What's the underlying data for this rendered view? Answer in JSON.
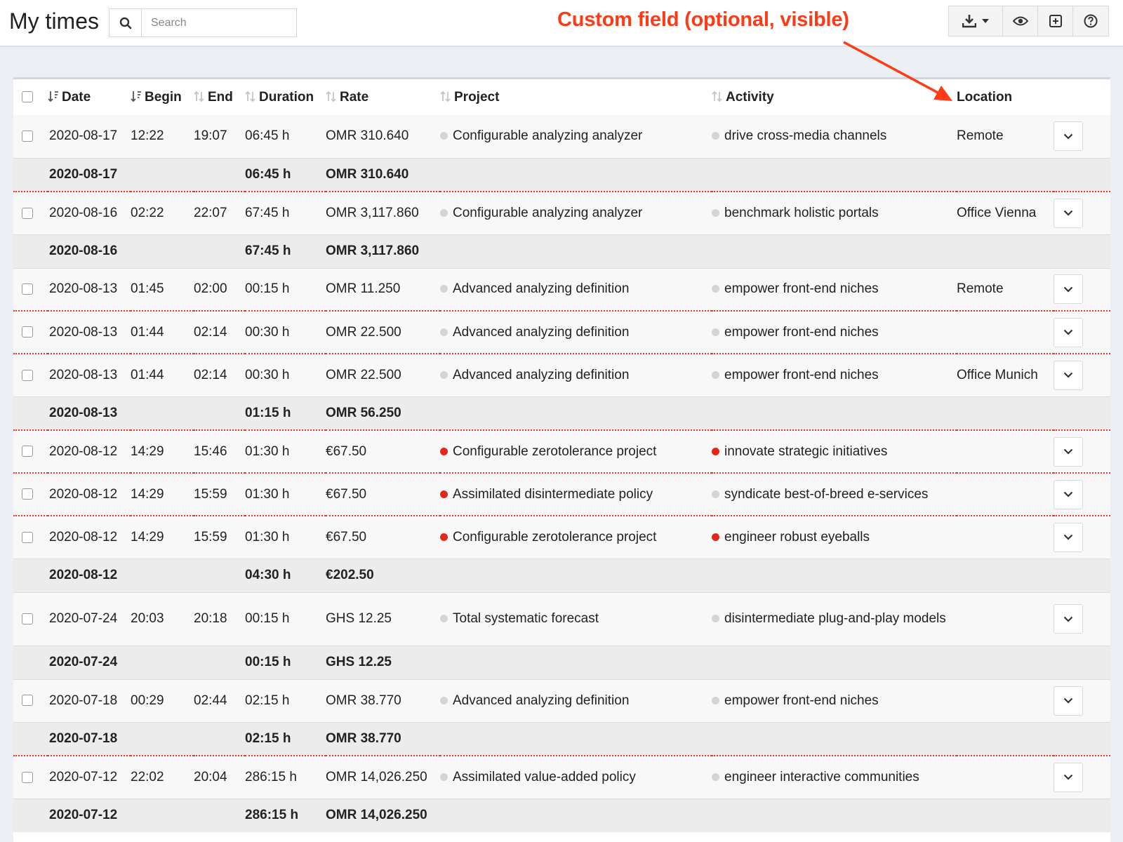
{
  "header": {
    "title": "My times",
    "search_placeholder": "Search",
    "annotation": "Custom field (optional, visible)"
  },
  "toolbar": {
    "icons": [
      "download-icon",
      "caret-down-icon",
      "eye-icon",
      "plus-square-icon",
      "help-icon"
    ]
  },
  "colors": {
    "annotation": "#ff3a17",
    "divider": "#e03a2a",
    "dot_red": "#e4271b",
    "dot_grey": "#d4d4d4"
  },
  "table": {
    "columns": {
      "date": "Date",
      "begin": "Begin",
      "end": "End",
      "duration": "Duration",
      "rate": "Rate",
      "project": "Project",
      "activity": "Activity",
      "location": "Location"
    },
    "rows": [
      {
        "type": "entry",
        "date": "2020-08-17",
        "begin": "12:22",
        "end": "19:07",
        "duration": "06:45 h",
        "rate": "OMR 310.640",
        "project": "Configurable analyzing analyzer",
        "project_dot": "grey",
        "activity": "drive cross-media channels",
        "activity_dot": "grey",
        "location": "Remote",
        "sep": "solid"
      },
      {
        "type": "subtotal",
        "date": "2020-08-17",
        "duration": "06:45 h",
        "rate": "OMR 310.640",
        "sep": "dotted"
      },
      {
        "type": "entry",
        "date": "2020-08-16",
        "begin": "02:22",
        "end": "22:07",
        "duration": "67:45 h",
        "rate": "OMR 3,117.860",
        "project": "Configurable analyzing analyzer",
        "project_dot": "grey",
        "activity": "benchmark holistic portals",
        "activity_dot": "grey",
        "location": "Office Vienna",
        "sep": "solid"
      },
      {
        "type": "subtotal",
        "date": "2020-08-16",
        "duration": "67:45 h",
        "rate": "OMR 3,117.860",
        "sep": "solid"
      },
      {
        "type": "entry",
        "date": "2020-08-13",
        "begin": "01:45",
        "end": "02:00",
        "duration": "00:15 h",
        "rate": "OMR 11.250",
        "project": "Advanced analyzing definition",
        "project_dot": "grey",
        "activity": "empower front-end niches",
        "activity_dot": "grey",
        "location": "Remote",
        "sep": "dotted"
      },
      {
        "type": "entry",
        "date": "2020-08-13",
        "begin": "01:44",
        "end": "02:14",
        "duration": "00:30 h",
        "rate": "OMR 22.500",
        "project": "Advanced analyzing definition",
        "project_dot": "grey",
        "activity": "empower front-end niches",
        "activity_dot": "grey",
        "location": "",
        "sep": "dotted"
      },
      {
        "type": "entry",
        "date": "2020-08-13",
        "begin": "01:44",
        "end": "02:14",
        "duration": "00:30 h",
        "rate": "OMR 22.500",
        "project": "Advanced analyzing definition",
        "project_dot": "grey",
        "activity": "empower front-end niches",
        "activity_dot": "grey",
        "location": "Office Munich",
        "sep": "solid"
      },
      {
        "type": "subtotal",
        "date": "2020-08-13",
        "duration": "01:15 h",
        "rate": "OMR 56.250",
        "sep": "dotted"
      },
      {
        "type": "entry",
        "date": "2020-08-12",
        "begin": "14:29",
        "end": "15:46",
        "duration": "01:30 h",
        "rate": "€67.50",
        "project": "Configurable zerotolerance project",
        "project_dot": "red",
        "activity": "innovate strategic initiatives",
        "activity_dot": "red",
        "location": "",
        "sep": "dotted"
      },
      {
        "type": "entry",
        "date": "2020-08-12",
        "begin": "14:29",
        "end": "15:59",
        "duration": "01:30 h",
        "rate": "€67.50",
        "project": "Assimilated disintermediate policy",
        "project_dot": "red",
        "activity": "syndicate best-of-breed e-services",
        "activity_dot": "grey",
        "location": "",
        "sep": "dotted"
      },
      {
        "type": "entry",
        "date": "2020-08-12",
        "begin": "14:29",
        "end": "15:59",
        "duration": "01:30 h",
        "rate": "€67.50",
        "project": "Configurable zerotolerance project",
        "project_dot": "red",
        "activity": "engineer robust eyeballs",
        "activity_dot": "red",
        "location": "",
        "sep": "solid"
      },
      {
        "type": "subtotal",
        "date": "2020-08-12",
        "duration": "04:30 h",
        "rate": "€202.50",
        "sep": "solid"
      },
      {
        "type": "entry",
        "tall": true,
        "date": "2020-07-24",
        "begin": "20:03",
        "end": "20:18",
        "duration": "00:15 h",
        "rate": "GHS 12.25",
        "project": "Total systematic forecast",
        "project_dot": "grey",
        "activity": "disintermediate plug-and-play models",
        "activity_dot": "grey",
        "location": "",
        "sep": "solid"
      },
      {
        "type": "subtotal",
        "date": "2020-07-24",
        "duration": "00:15 h",
        "rate": "GHS 12.25",
        "sep": "solid"
      },
      {
        "type": "entry",
        "date": "2020-07-18",
        "begin": "00:29",
        "end": "02:44",
        "duration": "02:15 h",
        "rate": "OMR 38.770",
        "project": "Advanced analyzing definition",
        "project_dot": "grey",
        "activity": "empower front-end niches",
        "activity_dot": "grey",
        "location": "",
        "sep": "solid"
      },
      {
        "type": "subtotal",
        "date": "2020-07-18",
        "duration": "02:15 h",
        "rate": "OMR 38.770",
        "sep": "dotted"
      },
      {
        "type": "entry",
        "date": "2020-07-12",
        "begin": "22:02",
        "end": "20:04",
        "duration": "286:15 h",
        "rate": "OMR 14,026.250",
        "project": "Assimilated value-added policy",
        "project_dot": "grey",
        "activity": "engineer interactive communities",
        "activity_dot": "grey",
        "location": "",
        "sep": "solid"
      },
      {
        "type": "subtotal",
        "date": "2020-07-12",
        "duration": "286:15 h",
        "rate": "OMR 14,026.250",
        "sep": "none"
      }
    ]
  }
}
